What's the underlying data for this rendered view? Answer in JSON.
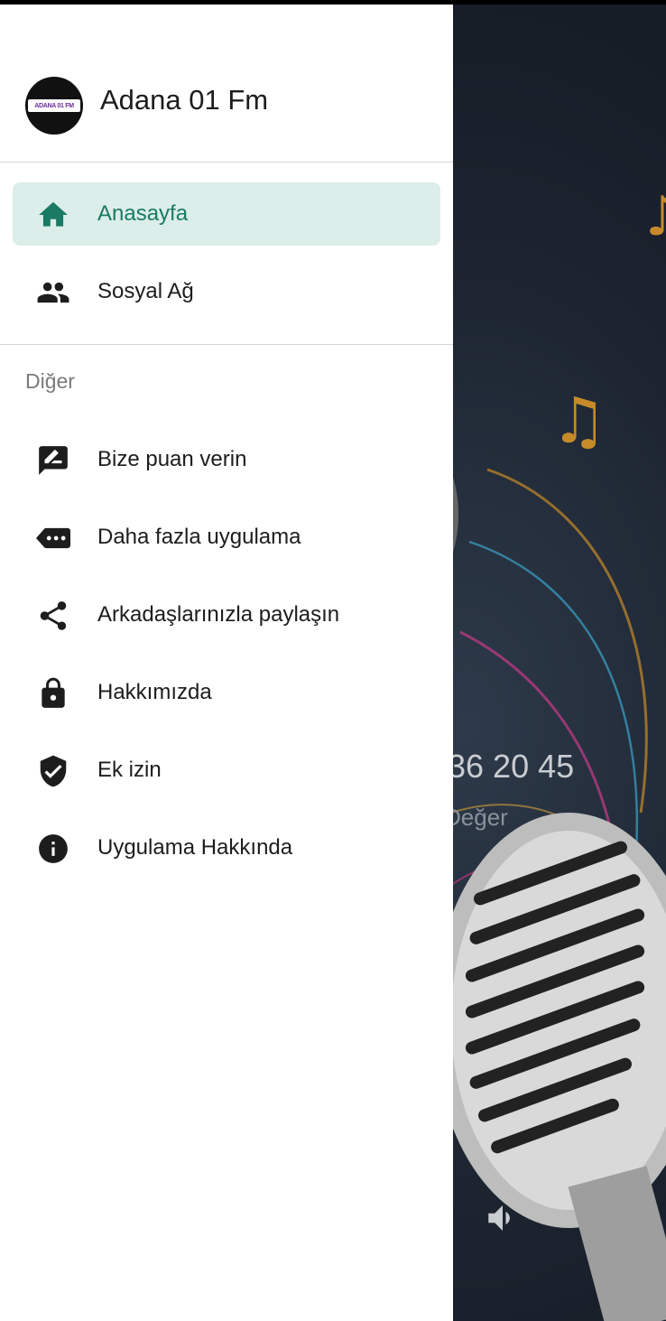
{
  "header": {
    "app_title": "Adana 01 Fm",
    "logo_text": "ADANA 01 FM"
  },
  "nav": {
    "primary": [
      {
        "label": "Anasayfa",
        "icon": "home-icon",
        "active": true
      },
      {
        "label": "Sosyal Ağ",
        "icon": "people-icon",
        "active": false
      }
    ],
    "section_title": "Diğer",
    "secondary": [
      {
        "label": "Bize puan verin",
        "icon": "rate-review-icon"
      },
      {
        "label": "Daha fazla uygulama",
        "icon": "more-apps-icon"
      },
      {
        "label": "Arkadaşlarınızla paylaşın",
        "icon": "share-icon"
      },
      {
        "label": "Hakkımızda",
        "icon": "lock-icon"
      },
      {
        "label": "Ek izin",
        "icon": "shield-check-icon"
      },
      {
        "label": "Uygulama Hakkında",
        "icon": "info-icon"
      }
    ]
  },
  "background": {
    "number_text": "36 20 45",
    "sub_text": "Değer",
    "volume_icon": "volume-icon"
  },
  "colors": {
    "accent": "#1a7a64",
    "active_bg": "#dceee9"
  }
}
